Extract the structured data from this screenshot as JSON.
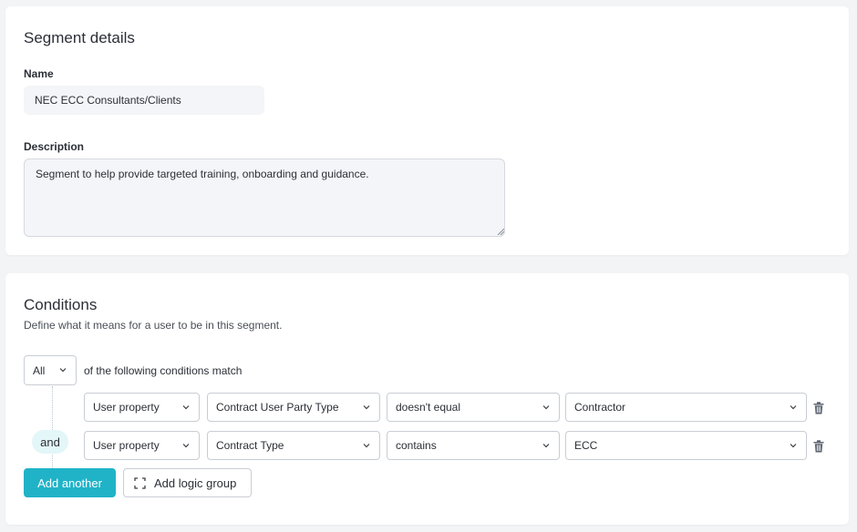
{
  "details": {
    "title": "Segment details",
    "name_label": "Name",
    "name_value": "NEC ECC Consultants/Clients",
    "description_label": "Description",
    "description_value": "Segment to help provide targeted training, onboarding and guidance."
  },
  "conditions": {
    "title": "Conditions",
    "subtitle": "Define what it means for a user to be in this segment.",
    "match_mode": "All",
    "match_text": "of the following conditions match",
    "joiner": "and",
    "rows": [
      {
        "type": "User property",
        "property": "Contract User Party Type",
        "operator": "doesn't equal",
        "value": "Contractor"
      },
      {
        "type": "User property",
        "property": "Contract Type",
        "operator": "contains",
        "value": "ECC"
      }
    ],
    "add_another_label": "Add another",
    "add_logic_group_label": "Add logic group"
  },
  "colors": {
    "accent": "#20b3c8",
    "joiner_bg": "#e3f6f8",
    "field_bg": "#f4f5f8"
  },
  "icons": [
    "chevron-down-icon",
    "trash-icon",
    "logic-group-icon",
    "resize-handle-icon"
  ]
}
